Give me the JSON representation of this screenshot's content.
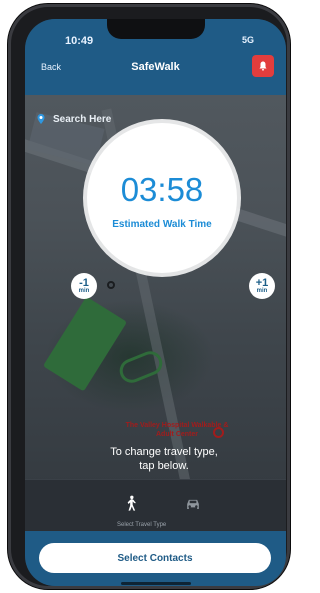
{
  "status": {
    "time": "10:49",
    "network": "5G"
  },
  "nav": {
    "back_label": "Back",
    "title": "SafeWalk"
  },
  "search": {
    "placeholder": "Search Here"
  },
  "timer": {
    "value": "03:58",
    "label": "Estimated Walk Time"
  },
  "adjust": {
    "minus": {
      "value": "-1",
      "unit": "min"
    },
    "plus": {
      "value": "+1",
      "unit": "min"
    }
  },
  "map": {
    "place_label": "The Valley Hospital Walkable & Adult Center"
  },
  "instruction": "To change travel type, tap below.",
  "modes": {
    "caption": "Select Travel Type",
    "items": [
      "walk-icon",
      "car-icon"
    ]
  },
  "bottom": {
    "select_contacts_label": "Select Contacts"
  },
  "colors": {
    "primary": "#1f5b86",
    "accent": "#1c8cd6",
    "alert": "#e23d3d"
  }
}
